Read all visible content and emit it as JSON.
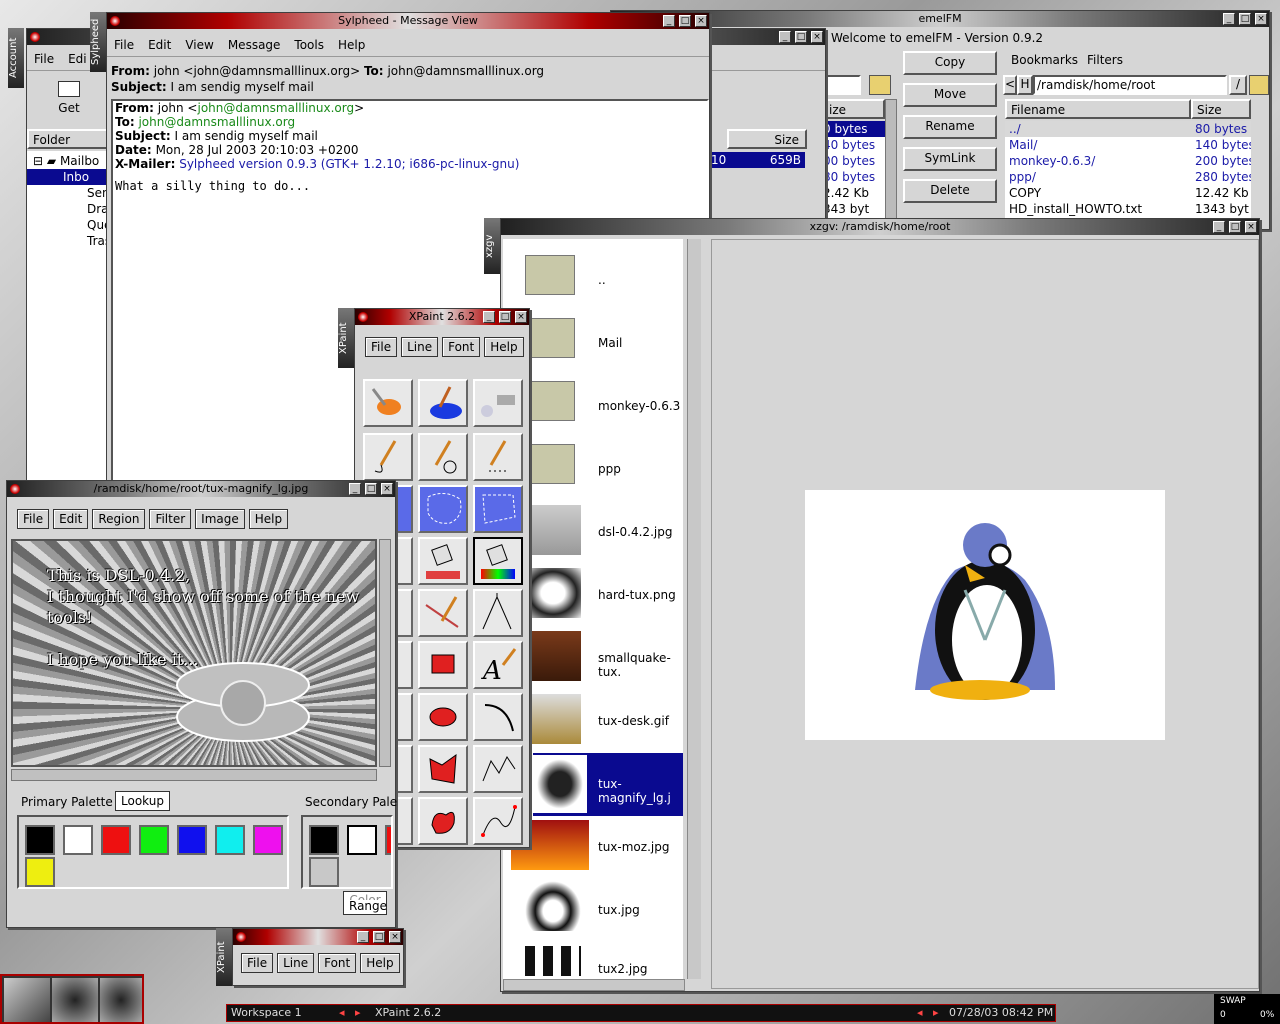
{
  "emelfm": {
    "title": "emelFM",
    "welcome": "Welcome to emelFM - Version 0.9.2",
    "buttons": [
      "Copy",
      "Move",
      "Rename",
      "SymLink",
      "Delete"
    ],
    "bookmarks_label": "Bookmarks",
    "filters_label": "Filters",
    "path": "/ramdisk/home/root",
    "h_label": "H",
    "left_label": "<",
    "slash_label": "/",
    "col_filename": "Filename",
    "col_size": "Size",
    "col_size_left": "ize",
    "left_sizes": [
      "0 bytes",
      "40 bytes",
      "00 bytes",
      "80 bytes",
      "2.42 Kb",
      "343 byt"
    ],
    "files": [
      {
        "name": "../",
        "size": "80 bytes"
      },
      {
        "name": "Mail/",
        "size": "140 bytes"
      },
      {
        "name": "monkey-0.6.3/",
        "size": "200 bytes"
      },
      {
        "name": "ppp/",
        "size": "280 bytes"
      },
      {
        "name": "COPY",
        "size": "12.42 Kb"
      },
      {
        "name": "HD_install_HOWTO.txt",
        "size": "1343 byt"
      }
    ]
  },
  "sylpheed": {
    "title": "Sylpheed - Message View",
    "vtab": "Sylpheed",
    "menu": [
      "File",
      "Edit",
      "View",
      "Message",
      "Tools",
      "Help"
    ],
    "from_label": "From:",
    "from_value": "john <john@damnsmalllinux.org>",
    "to_label": "To:",
    "to_value": "john@damnsmalllinux.org",
    "subject_label": "Subject:",
    "subject_value": "I am sendig myself mail",
    "body_from_name": "john <",
    "body_from_email": "john@damnsmalllinux.org",
    "body_from_close": ">",
    "body_to": "john@damnsmalllinux.org",
    "body_subject": "I am sendig myself mail",
    "date_label": "Date:",
    "date_value": "Mon, 28 Jul 2003 20:10:03 +0200",
    "xmailer_label": "X-Mailer:",
    "xmailer_value": "Sylpheed version 0.9.3 (GTK+ 1.2.10; i686-pc-linux-gnu)",
    "body_text": "What a silly thing to do..."
  },
  "sylmain": {
    "vtab": "Account",
    "menu": [
      "File",
      "Edi"
    ],
    "get_label": "Get",
    "folder_label": "Folder",
    "folders": [
      "Mailbo",
      "Inbo",
      "Sen",
      "Dra",
      "Que",
      "Tras"
    ],
    "size_header": "Size",
    "row_left": "10",
    "row_size": "659B"
  },
  "xzgv": {
    "title": "xzgv: /ramdisk/home/root",
    "vtab": "xzgv",
    "items": [
      "..",
      "Mail",
      "monkey-0.6.3",
      "ppp",
      "dsl-0.4.2.jpg",
      "hard-tux.png",
      "smallquake-tux.",
      "tux-desk.gif",
      "tux-magnify_lg.j",
      "tux-moz.jpg",
      "tux.jpg",
      "tux2.jpg"
    ]
  },
  "xpaint": {
    "title": "XPaint 2.6.2",
    "vtab": "XPaint",
    "menu": [
      "File",
      "Line",
      "Font",
      "Help"
    ]
  },
  "xpaint_small": {
    "vtab": "XPaint",
    "menu": [
      "File",
      "Line",
      "Font",
      "Help"
    ]
  },
  "imgwin": {
    "title": "/ramdisk/home/root/tux-magnify_lg.jpg",
    "menu": [
      "File",
      "Edit",
      "Region",
      "Filter",
      "Image",
      "Help"
    ],
    "canvas_line1": "This is DSL-0.4.2,",
    "canvas_line2": "I thought I'd show off some of the new tools!",
    "canvas_line3": "I hope you like it...",
    "primary_label": "Primary Palette",
    "lookup_label": "Lookup",
    "secondary_label": "Secondary Pale",
    "color_label": "Color",
    "range_label": "Range",
    "primary_colors": [
      "#000000",
      "#ffffff",
      "#ee1010",
      "#10ee10",
      "#1010ee",
      "#10eeee",
      "#ee10ee",
      "#eeee10"
    ],
    "secondary_colors": [
      "#000000",
      "#ffffff",
      "#ee1010",
      "#c8c8c8"
    ]
  },
  "taskbar": {
    "workspace": "Workspace 1",
    "task": "XPaint 2.6.2",
    "clock": "07/28/03 08:42 PM",
    "swap_label": "SWAP",
    "swap_a": "0",
    "swap_b": "0%"
  }
}
